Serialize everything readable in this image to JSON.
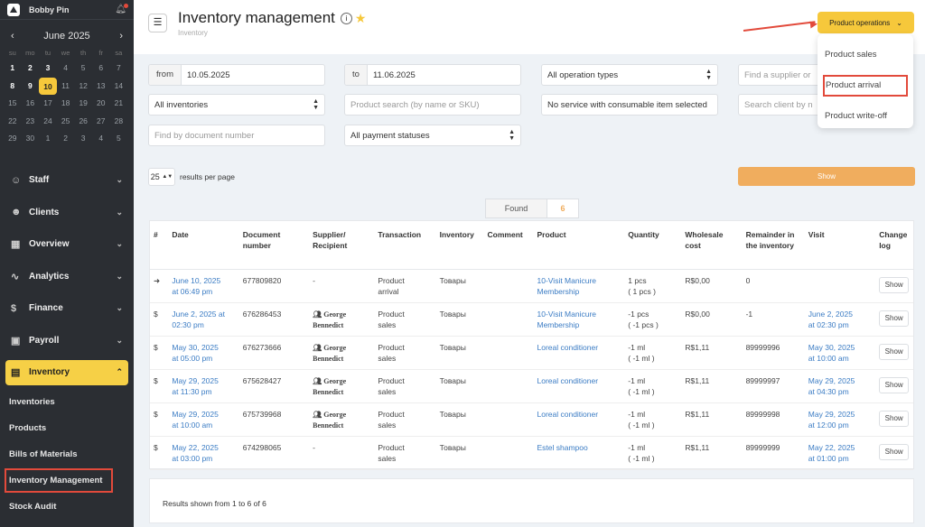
{
  "sidebar": {
    "user_name": "Bobby Pin",
    "calendar": {
      "prev": "‹",
      "month": "June 2025",
      "next": "›",
      "weekdays": [
        "su",
        "mo",
        "tu",
        "we",
        "th",
        "fr",
        "sa"
      ],
      "days": [
        {
          "d": "1",
          "b": true
        },
        {
          "d": "2",
          "b": true
        },
        {
          "d": "3",
          "b": true
        },
        {
          "d": "4"
        },
        {
          "d": "5"
        },
        {
          "d": "6"
        },
        {
          "d": "7"
        },
        {
          "d": "8",
          "b": true
        },
        {
          "d": "9",
          "b": true
        },
        {
          "d": "10",
          "sel": true
        },
        {
          "d": "11"
        },
        {
          "d": "12"
        },
        {
          "d": "13"
        },
        {
          "d": "14"
        },
        {
          "d": "15"
        },
        {
          "d": "16"
        },
        {
          "d": "17"
        },
        {
          "d": "18"
        },
        {
          "d": "19"
        },
        {
          "d": "20"
        },
        {
          "d": "21"
        },
        {
          "d": "22"
        },
        {
          "d": "23"
        },
        {
          "d": "24"
        },
        {
          "d": "25"
        },
        {
          "d": "26"
        },
        {
          "d": "27"
        },
        {
          "d": "28"
        },
        {
          "d": "29"
        },
        {
          "d": "30"
        },
        {
          "d": "1"
        },
        {
          "d": "2"
        },
        {
          "d": "3"
        },
        {
          "d": "4"
        },
        {
          "d": "5"
        }
      ]
    },
    "nav": [
      {
        "label": "Staff",
        "icon": "person-icon",
        "glyph": "☺"
      },
      {
        "label": "Clients",
        "icon": "people-icon",
        "glyph": "☻"
      },
      {
        "label": "Overview",
        "icon": "grid-icon",
        "glyph": "▦"
      },
      {
        "label": "Analytics",
        "icon": "chart-icon",
        "glyph": "∿"
      },
      {
        "label": "Finance",
        "icon": "coin-icon",
        "glyph": "$"
      },
      {
        "label": "Payroll",
        "icon": "payroll-icon",
        "glyph": "▣"
      }
    ],
    "active": {
      "label": "Inventory",
      "icon": "boxes-icon",
      "glyph": "▤"
    },
    "sub": [
      "Inventories",
      "Products",
      "Bills of Materials",
      "Inventory Management",
      "Stock Audit"
    ]
  },
  "header": {
    "title": "Inventory management",
    "breadcrumb": "Inventory",
    "ops_button": "Product operations",
    "dropdown": [
      "Product sales",
      "Product arrival",
      "Product write-off"
    ]
  },
  "filters": {
    "from_label": "from",
    "from_value": "10.05.2025",
    "to_label": "to",
    "to_value": "11.06.2025",
    "operation_types": "All operation types",
    "supplier_ph": "Find a supplier or",
    "inventories": "All inventories",
    "product_search_ph": "Product search (by name or SKU)",
    "service": "No service with consumable item selected",
    "client_ph": "Search client by n",
    "doc_number_ph": "Find by document number",
    "payment_statuses": "All payment statuses",
    "per_page": "25",
    "per_page_label": "results per page",
    "show_button": "Show"
  },
  "found": {
    "label": "Found",
    "count": "6"
  },
  "table": {
    "headers": [
      "#",
      "Date",
      "Document number",
      "Supplier/ Recipient",
      "Transaction",
      "Inventory",
      "Comment",
      "Product",
      "Quantity",
      "Wholesale cost",
      "Remainder in the inventory",
      "Visit",
      "Change log"
    ],
    "rows": [
      {
        "icon": "➜",
        "date1": "June 10, 2025",
        "date2": "at 06:49 pm",
        "doc": "677809820",
        "sup": "-",
        "tr1": "Product",
        "tr2": "arrival",
        "inv": "Товары",
        "comment": "",
        "prod1": "10-Visit Manicure",
        "prod2": "Membership",
        "q1": "1 pcs",
        "q2": "( 1 pcs )",
        "cost": "R$0,00",
        "rem": "0",
        "v1": "",
        "v2": "",
        "chg": "Show"
      },
      {
        "icon": "$",
        "date1": "June 2, 2025 at",
        "date2": "02:30 pm",
        "doc": "676286453",
        "sup": "George Bennedict",
        "tr1": "Product",
        "tr2": "sales",
        "inv": "Товары",
        "comment": "",
        "prod1": "10-Visit Manicure",
        "prod2": "Membership",
        "q1": "-1 pcs",
        "q2": "( -1 pcs )",
        "cost": "R$0,00",
        "rem": "-1",
        "v1": "June 2, 2025",
        "v2": "at 02:30 pm",
        "chg": "Show"
      },
      {
        "icon": "$",
        "date1": "May 30, 2025",
        "date2": "at 05:00 pm",
        "doc": "676273666",
        "sup": "George Bennedict",
        "tr1": "Product",
        "tr2": "sales",
        "inv": "Товары",
        "comment": "",
        "prod1": "Loreal conditioner",
        "prod2": "",
        "q1": "-1 ml",
        "q2": "( -1 ml )",
        "cost": "R$1,11",
        "rem": "89999996",
        "v1": "May 30, 2025",
        "v2": "at 10:00 am",
        "chg": "Show"
      },
      {
        "icon": "$",
        "date1": "May 29, 2025",
        "date2": "at 11:30 pm",
        "doc": "675628427",
        "sup": "George Bennedict",
        "tr1": "Product",
        "tr2": "sales",
        "inv": "Товары",
        "comment": "",
        "prod1": "Loreal conditioner",
        "prod2": "",
        "q1": "-1 ml",
        "q2": "( -1 ml )",
        "cost": "R$1,11",
        "rem": "89999997",
        "v1": "May 29, 2025",
        "v2": "at 04:30 pm",
        "chg": "Show"
      },
      {
        "icon": "$",
        "date1": "May 29, 2025",
        "date2": "at 10:00 am",
        "doc": "675739968",
        "sup": "George Bennedict",
        "tr1": "Product",
        "tr2": "sales",
        "inv": "Товары",
        "comment": "",
        "prod1": "Loreal conditioner",
        "prod2": "",
        "q1": "-1 ml",
        "q2": "( -1 ml )",
        "cost": "R$1,11",
        "rem": "89999998",
        "v1": "May 29, 2025",
        "v2": "at 12:00 pm",
        "chg": "Show"
      },
      {
        "icon": "$",
        "date1": "May 22, 2025",
        "date2": "at 03:00 pm",
        "doc": "674298065",
        "sup": "-",
        "tr1": "Product",
        "tr2": "sales",
        "inv": "Товары",
        "comment": "",
        "prod1": "Estel shampoo",
        "prod2": "",
        "q1": "-1 ml",
        "q2": "( -1 ml )",
        "cost": "R$1,11",
        "rem": "89999999",
        "v1": "May 22, 2025",
        "v2": "at 01:00 pm",
        "chg": "Show"
      }
    ]
  },
  "footer": "Results shown from 1 to 6 of 6",
  "colors": {
    "accent": "#f6c83b",
    "show_button": "#f0ad5e",
    "highlight": "#e24a3b",
    "link": "#3b7cc4",
    "sidebar": "#2b2e33"
  }
}
